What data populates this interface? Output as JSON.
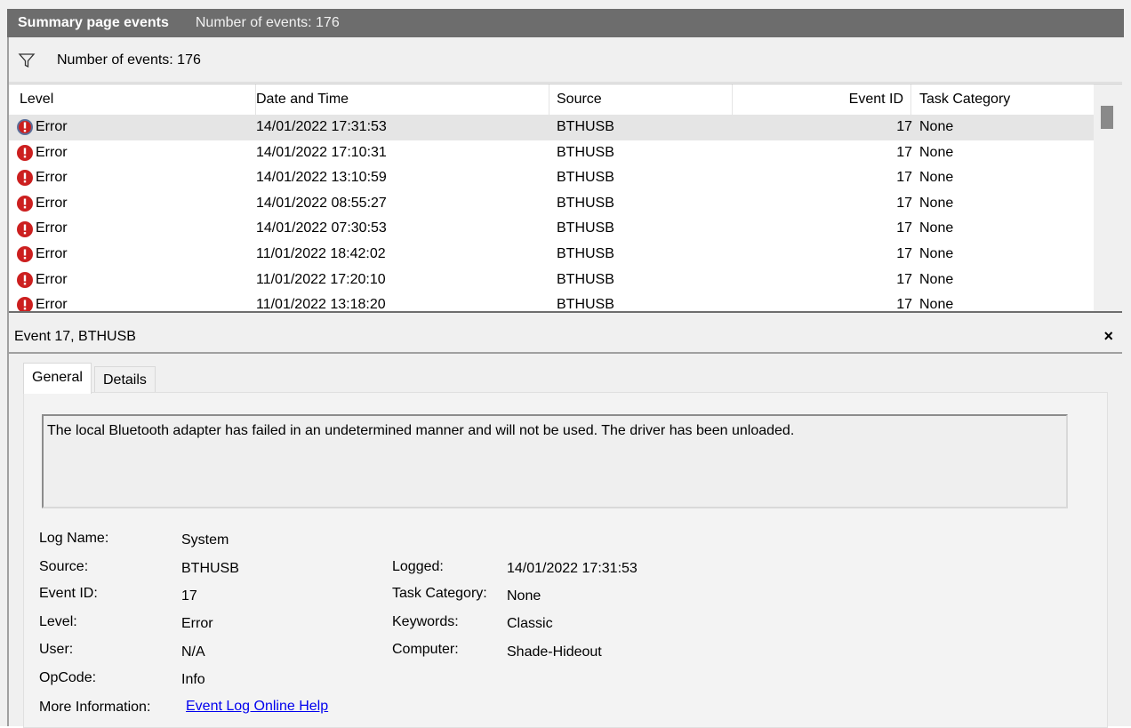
{
  "title": {
    "primary": "Summary page events",
    "secondary": "Number of events: 176"
  },
  "filter": {
    "icon": "filter-icon",
    "text": "Number of events: 176"
  },
  "columns": {
    "level": "Level",
    "date": "Date and Time",
    "source": "Source",
    "event_id": "Event ID",
    "task_category": "Task Category"
  },
  "rows": [
    {
      "level": "Error",
      "date": "14/01/2022 17:31:53",
      "source": "BTHUSB",
      "event_id": "17",
      "category": "None",
      "selected": true
    },
    {
      "level": "Error",
      "date": "14/01/2022 17:10:31",
      "source": "BTHUSB",
      "event_id": "17",
      "category": "None"
    },
    {
      "level": "Error",
      "date": "14/01/2022 13:10:59",
      "source": "BTHUSB",
      "event_id": "17",
      "category": "None"
    },
    {
      "level": "Error",
      "date": "14/01/2022 08:55:27",
      "source": "BTHUSB",
      "event_id": "17",
      "category": "None"
    },
    {
      "level": "Error",
      "date": "14/01/2022 07:30:53",
      "source": "BTHUSB",
      "event_id": "17",
      "category": "None"
    },
    {
      "level": "Error",
      "date": "11/01/2022 18:42:02",
      "source": "BTHUSB",
      "event_id": "17",
      "category": "None"
    },
    {
      "level": "Error",
      "date": "11/01/2022 17:20:10",
      "source": "BTHUSB",
      "event_id": "17",
      "category": "None"
    },
    {
      "level": "Error",
      "date": "11/01/2022 13:18:20",
      "source": "BTHUSB",
      "event_id": "17",
      "category": "None"
    }
  ],
  "detail": {
    "title": "Event 17, BTHUSB",
    "close": "×",
    "tabs": {
      "general": "General",
      "details": "Details"
    },
    "message": "The local Bluetooth adapter has failed in an undetermined manner and will not be used. The driver has been unloaded.",
    "labels": {
      "log_name": "Log Name:",
      "source": "Source:",
      "event_id": "Event ID:",
      "level": "Level:",
      "user": "User:",
      "opcode": "OpCode:",
      "more_info": "More Information:",
      "logged": "Logged:",
      "task_category": "Task Category:",
      "keywords": "Keywords:",
      "computer": "Computer:"
    },
    "values": {
      "log_name": "System",
      "source": "BTHUSB",
      "event_id": "17",
      "level": "Error",
      "user": "N/A",
      "opcode": "Info",
      "more_info_link": "Event Log Online Help",
      "logged": "14/01/2022 17:31:53",
      "task_category": "None",
      "keywords": "Classic",
      "computer": "Shade-Hideout"
    }
  },
  "colors": {
    "titlebar": "#6d6d6d",
    "error_icon": "#cc1f1f",
    "selected_row": "#e5e5e5",
    "link": "#0000ee"
  }
}
